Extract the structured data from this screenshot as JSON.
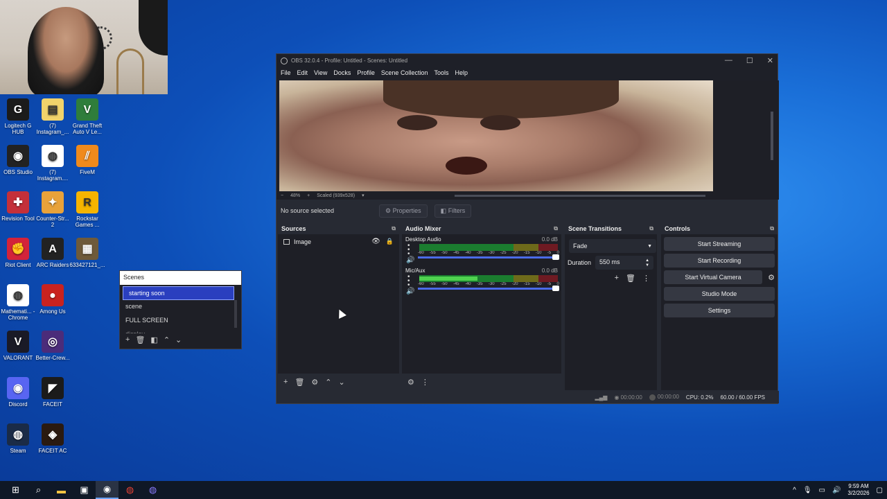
{
  "desktop": {
    "icons": [
      {
        "label": "Logitech G HUB",
        "glyph": "G",
        "color": "#1b1b1b"
      },
      {
        "label": "(7) Instagram_...",
        "glyph": "▤",
        "color": "#f1d36b"
      },
      {
        "label": "Grand Theft Auto V Le...",
        "glyph": "V",
        "color": "#2f7d3b"
      },
      {
        "label": "OBS Studio",
        "glyph": "◉",
        "color": "#222"
      },
      {
        "label": "(7) Instagram....",
        "glyph": "◍",
        "color": "#ffffff"
      },
      {
        "label": "FiveM",
        "glyph": "⫽",
        "color": "#f08a1c"
      },
      {
        "label": "Revision Tool",
        "glyph": "✚",
        "color": "#c4303a"
      },
      {
        "label": "Counter-Str... 2",
        "glyph": "✦",
        "color": "#e8a23a"
      },
      {
        "label": "Rockstar Games ...",
        "glyph": "R",
        "color": "#f5b400"
      },
      {
        "label": "Riot Client",
        "glyph": "✊",
        "color": "#d3233a"
      },
      {
        "label": "ARC Raiders",
        "glyph": "A",
        "color": "#222"
      },
      {
        "label": "633427121_...",
        "glyph": "▦",
        "color": "#6e5a3a"
      },
      {
        "label": "Mathemati... - Chrome",
        "glyph": "◍",
        "color": "#ffffff"
      },
      {
        "label": "Among Us",
        "glyph": "●",
        "color": "#c9221f"
      },
      {
        "label": "VALORANT",
        "glyph": "V",
        "color": "#1a1a26"
      },
      {
        "label": "Better-Crew...",
        "glyph": "◎",
        "color": "#4b2c7a"
      },
      {
        "label": "Discord",
        "glyph": "◉",
        "color": "#5865f2"
      },
      {
        "label": "FACEIT",
        "glyph": "◤",
        "color": "#1b1b1b"
      },
      {
        "label": "Steam",
        "glyph": "◍",
        "color": "#1a2b47"
      },
      {
        "label": "FACEIT AC",
        "glyph": "◈",
        "color": "#2a1a10"
      }
    ]
  },
  "scenes_dock": {
    "title": "Scenes",
    "items": [
      "starting soon",
      "scene",
      "FULL SCREEN",
      "display"
    ],
    "active_index": 0
  },
  "obs": {
    "window_title": "OBS 32.0.4 - Profile: Untitled - Scenes: Untitled",
    "menu": [
      "File",
      "Edit",
      "View",
      "Docks",
      "Profile",
      "Scene Collection",
      "Tools",
      "Help"
    ],
    "zoom": {
      "minus": "−",
      "percent": "48%",
      "plus": "+",
      "scale_mode": "Scaled (939x528)"
    },
    "context": {
      "no_source": "No source selected",
      "properties": "Properties",
      "filters": "Filters"
    },
    "sources": {
      "title": "Sources",
      "items": [
        {
          "name": "Image"
        }
      ]
    },
    "audio_mixer": {
      "title": "Audio Mixer",
      "ticks": [
        "-60",
        "-55",
        "-50",
        "-45",
        "-40",
        "-35",
        "-30",
        "-25",
        "-20",
        "-15",
        "-10",
        "-5",
        "0"
      ],
      "channels": [
        {
          "name": "Desktop Audio",
          "db": "0.0 dB",
          "level": 0.0
        },
        {
          "name": "Mic/Aux",
          "db": "0.0 dB",
          "level": 0.5
        }
      ]
    },
    "scene_transitions": {
      "title": "Scene Transitions",
      "transition": "Fade",
      "duration_label": "Duration",
      "duration_value": "550 ms"
    },
    "controls": {
      "title": "Controls",
      "start_streaming": "Start Streaming",
      "start_recording": "Start Recording",
      "start_virtual_camera": "Start Virtual Camera",
      "studio_mode": "Studio Mode",
      "settings": "Settings"
    },
    "status": {
      "stream_time": "00:00:00",
      "rec_time": "00:00:00",
      "cpu": "CPU: 0.2%",
      "fps": "60.00 / 60.00 FPS"
    }
  },
  "taskbar": {
    "time": "9:59 AM",
    "date": "3/2/2026",
    "tray_chevron": "^"
  }
}
